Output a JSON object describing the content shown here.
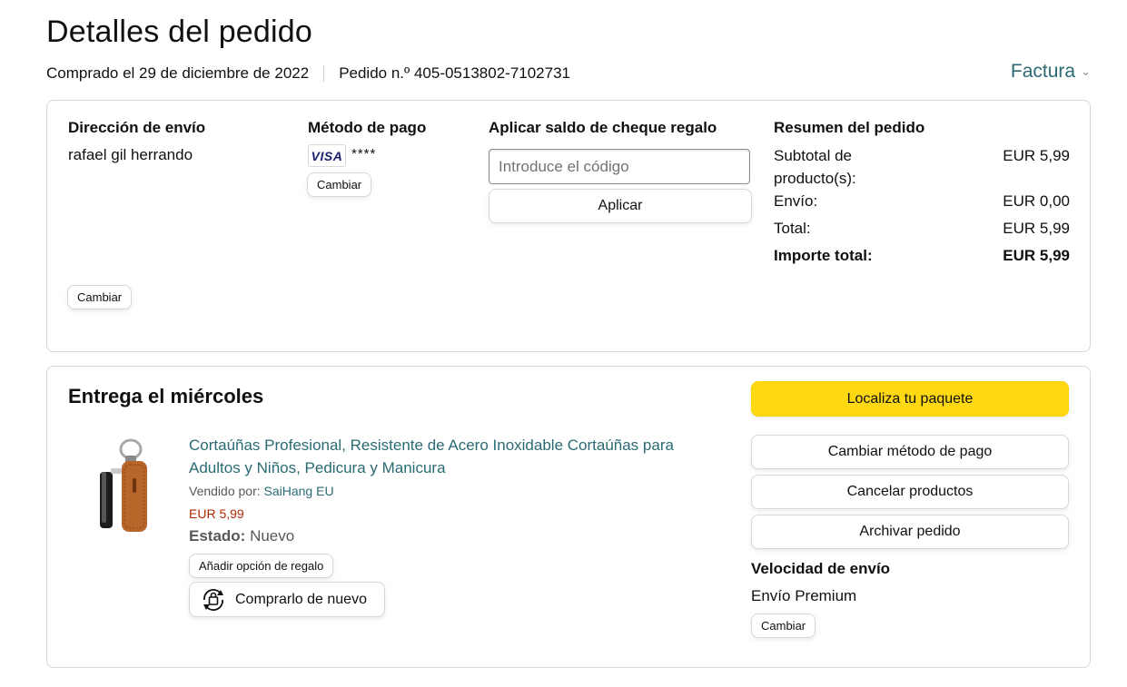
{
  "header": {
    "title": "Detalles del pedido",
    "purchased": "Comprado el 29 de diciembre de 2022",
    "order_number": "Pedido n.º 405-0513802-7102731",
    "invoice_label": "Factura"
  },
  "summary_box": {
    "shipping": {
      "heading": "Dirección de envío",
      "name": "rafael gil herrando",
      "change_label": "Cambiar"
    },
    "payment": {
      "heading": "Método de pago",
      "card_brand": "VISA",
      "card_masked": "****",
      "change_label": "Cambiar"
    },
    "gift_card": {
      "heading": "Aplicar saldo de cheque regalo",
      "placeholder": "Introduce el código",
      "apply_label": "Aplicar"
    },
    "order_summary": {
      "heading": "Resumen del pedido",
      "rows": [
        {
          "label": "Subtotal de producto(s):",
          "value": "EUR 5,99"
        },
        {
          "label": "Envío:",
          "value": "EUR 0,00"
        },
        {
          "label": "Total:",
          "value": "EUR 5,99"
        },
        {
          "label": "Importe total:",
          "value": "EUR 5,99"
        }
      ]
    }
  },
  "delivery": {
    "heading": "Entrega el miércoles",
    "product": {
      "title": "Cortaúñas Profesional, Resistente de Acero Inoxidable Cortaúñas para Adultos y Niños, Pedicura y Manicura",
      "sold_by_label": "Vendido por:",
      "seller": "SaiHang EU",
      "price": "EUR 5,99",
      "state_label": "Estado:",
      "state_value": "Nuevo",
      "gift_option_label": "Añadir opción de regalo",
      "buy_again_label": "Comprarlo de nuevo"
    },
    "actions": {
      "track": "Localiza tu paquete",
      "change_payment": "Cambiar método de pago",
      "cancel": "Cancelar productos",
      "archive": "Archivar pedido"
    },
    "shipping_speed": {
      "heading": "Velocidad de envío",
      "value": "Envío Premium",
      "change_label": "Cambiar"
    }
  },
  "colors": {
    "link": "#2a6b73",
    "price": "#b12704",
    "primary_button": "#ffd814",
    "border": "#d5d9d9"
  }
}
